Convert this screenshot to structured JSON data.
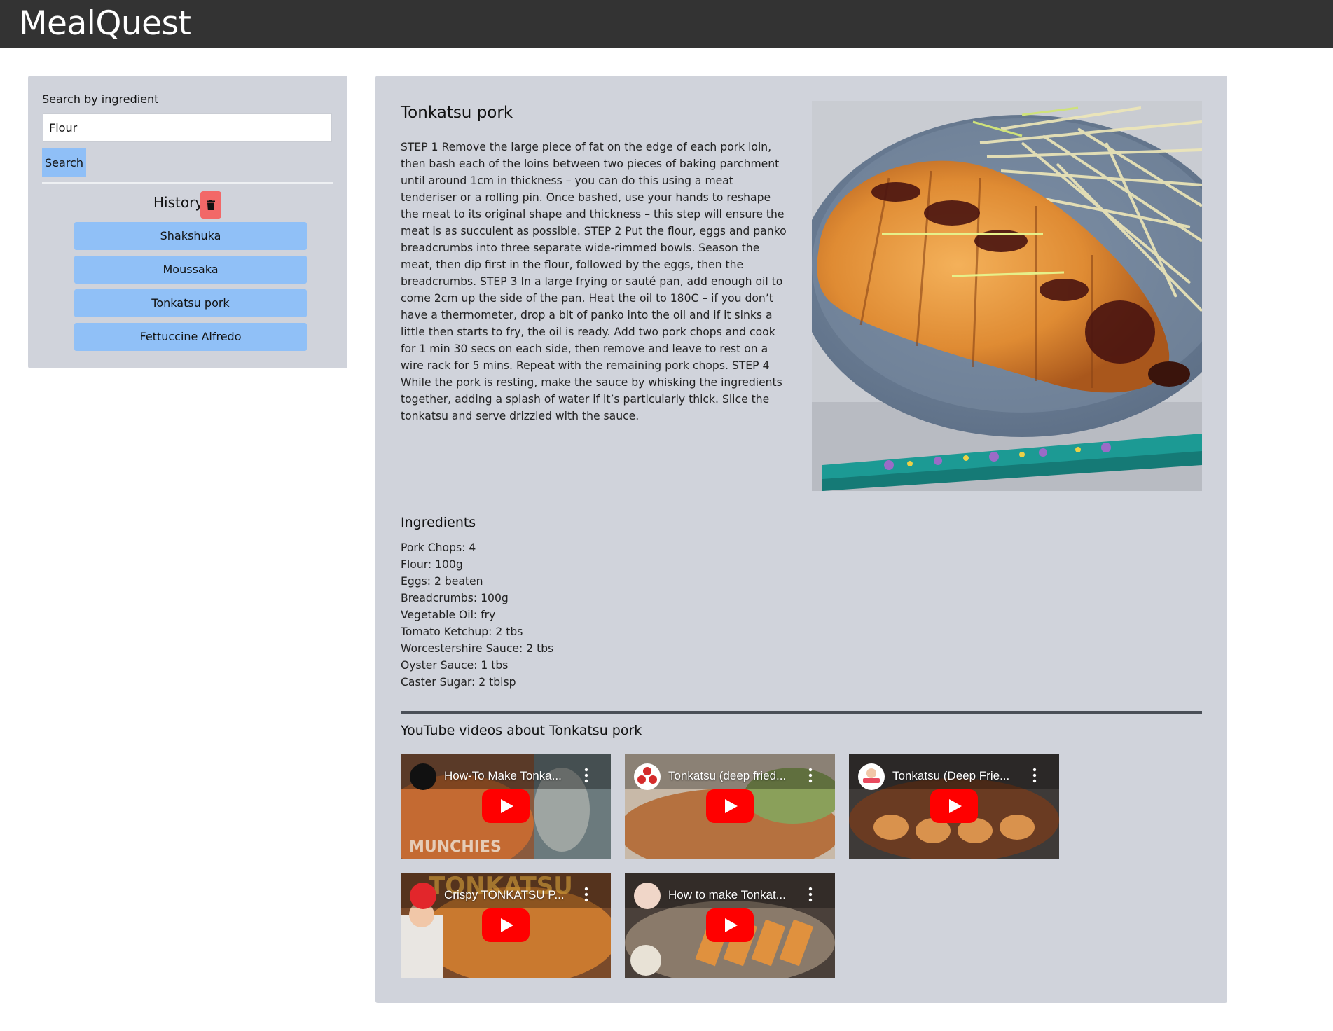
{
  "app": {
    "title": "MealQuest"
  },
  "search": {
    "label": "Search by ingredient",
    "value": "Flour",
    "button_label": "Search"
  },
  "history": {
    "label": "History",
    "items": [
      "Shakshuka",
      "Moussaka",
      "Tonkatsu pork",
      "Fettuccine Alfredo"
    ]
  },
  "recipe": {
    "title": "Tonkatsu pork",
    "instructions": "STEP 1 Remove the large piece of fat on the edge of each pork loin, then bash each of the loins between two pieces of baking parchment until around 1cm in thickness – you can do this using a meat tenderiser or a rolling pin. Once bashed, use your hands to reshape the meat to its original shape and thickness – this step will ensure the meat is as succulent as possible.  STEP 2 Put the flour, eggs and panko breadcrumbs into three separate wide-rimmed bowls. Season the meat, then dip first in the flour, followed by the eggs, then the breadcrumbs.  STEP 3 In a large frying or sauté pan, add enough oil to come 2cm up the side of the pan. Heat the oil to 180C – if you don’t have a thermometer, drop a bit of panko into the oil and if it sinks a little then starts to fry, the oil is ready. Add two pork chops and cook for 1 min 30 secs on each side, then remove and leave to rest on a wire rack for 5 mins. Repeat with the remaining pork chops.  STEP 4 While the pork is resting, make the sauce by whisking the ingredients together, adding a splash of water if it’s particularly thick. Slice the tonkatsu and serve drizzled with the sauce.",
    "ingredients_title": "Ingredients",
    "ingredients": [
      "Pork Chops: 4",
      "Flour: 100g",
      "Eggs: 2 beaten",
      "Breadcrumbs: 100g",
      "Vegetable Oil: fry",
      "Tomato Ketchup: 2 tbs",
      "Worcestershire Sauce: 2 tbs",
      "Oyster Sauce: 1 tbs",
      "Caster Sugar: 2 tblsp"
    ]
  },
  "videos": {
    "title": "YouTube videos about Tonkatsu pork",
    "items": [
      {
        "title": "How-To Make Tonka...",
        "channel_icon": "munchies-logo",
        "color": "#a8643a"
      },
      {
        "title": "Tonkatsu (deep fried...",
        "channel_icon": "red-dots-logo",
        "color": "#b07a58"
      },
      {
        "title": "Tonkatsu (Deep Frie...",
        "channel_icon": "yummy-kitchen-logo",
        "color": "#7a4a2a"
      },
      {
        "title": "Crispy TONKATSU P...",
        "channel_icon": "red-thumb-logo",
        "color": "#b5652b"
      },
      {
        "title": "How to make Tonkat...",
        "channel_icon": "chef-logo",
        "color": "#6b5648"
      }
    ]
  },
  "colors": {
    "topbar": "#333333",
    "panel": "#d0d3db",
    "accent_button": "#90c0f7",
    "trash_button": "#f26868",
    "youtube_red": "#ff0000"
  }
}
